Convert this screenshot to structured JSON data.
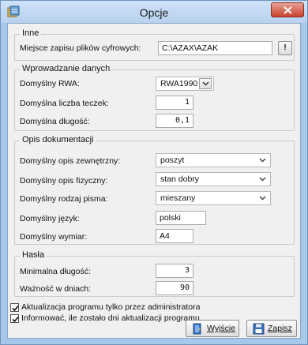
{
  "window": {
    "title": "Opcje"
  },
  "inne": {
    "legend": "Inne",
    "path_label": "Miejsce zapisu plików cyfrowych:",
    "path_value": "C:\\AZAX\\AZAK",
    "browse_label": "!"
  },
  "wprowadzanie": {
    "legend": "Wprowadzanie danych",
    "rwa_label": "Domyślny RWA:",
    "rwa_value": "RWA1990",
    "teczki_label": "Domyślna liczba teczek:",
    "teczki_value": "1",
    "dlugosc_label": "Domyślna długość:",
    "dlugosc_value": "0,1"
  },
  "opis": {
    "legend": "Opis dokumentacji",
    "zewn_label": "Domyślny opis zewnętrzny:",
    "zewn_value": "poszyt",
    "fiz_label": "Domyślny opis fizyczny:",
    "fiz_value": "stan dobry",
    "rodzaj_label": "Domyślny rodzaj pisma:",
    "rodzaj_value": "mieszany",
    "jezyk_label": "Domyślny język:",
    "jezyk_value": "polski",
    "wymiar_label": "Domyślny wymiar:",
    "wymiar_value": "A4"
  },
  "hasla": {
    "legend": "Hasła",
    "min_label": "Minimalna długość:",
    "min_value": "3",
    "waznosc_label": "Ważność w dniach:",
    "waznosc_value": "90"
  },
  "options": {
    "admin_label": "Aktualizacja programu tylko przez administratora",
    "admin_checked": true,
    "inform_label": "Informować, ile zostało dni aktualizacji programu",
    "inform_checked": true
  },
  "buttons": {
    "exit_label": "Wyjście",
    "save_label": "Zapisz"
  },
  "colors": {
    "accent": "#a8c8ea",
    "close": "#c7432c"
  }
}
